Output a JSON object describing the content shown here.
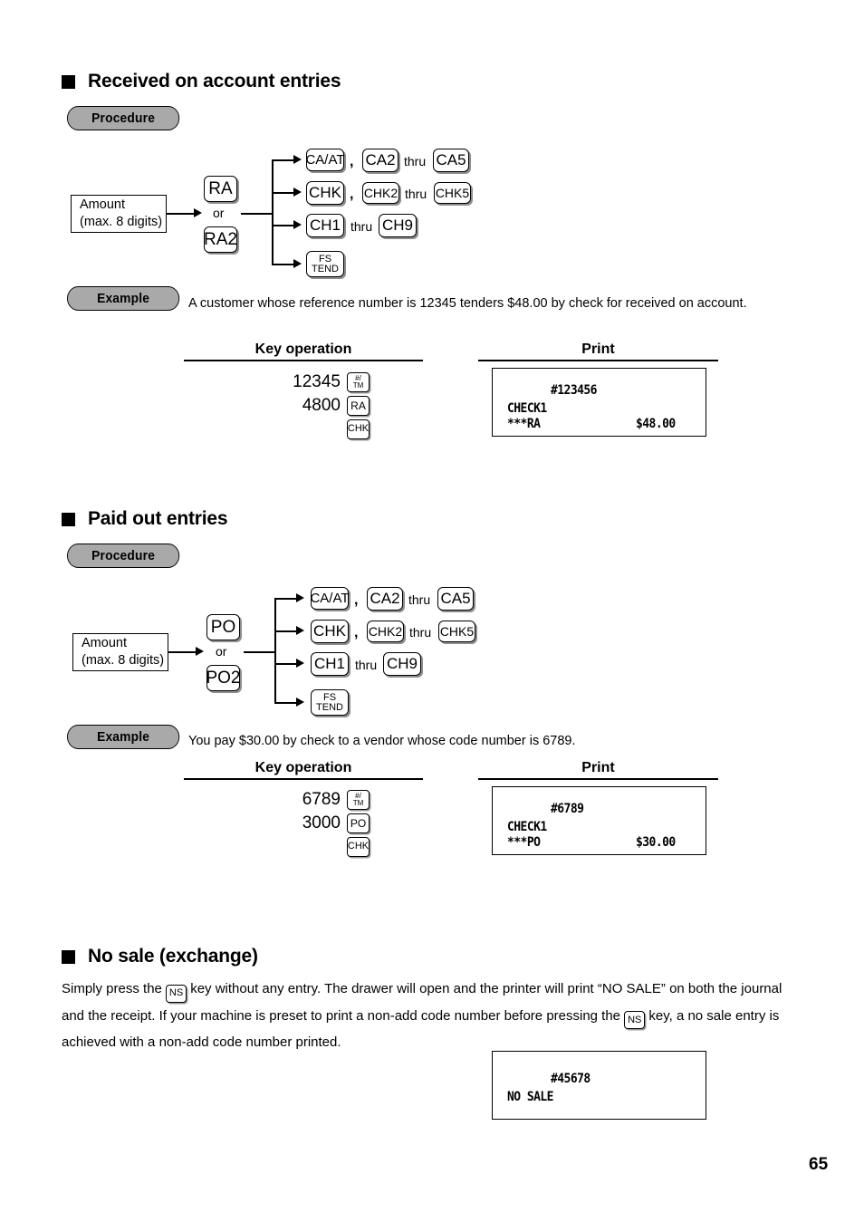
{
  "page": {
    "number": "65"
  },
  "sections": [
    {
      "id": "received-on-account",
      "heading": "Received on account entries",
      "procedure_badge": "Procedure",
      "example_badge": "Example",
      "example_text": "A customer whose reference number is 12345 tenders $48.00 by check for received on account.",
      "flow": {
        "amount_line1": "Amount",
        "amount_line2": "(max. 8 digits)",
        "or_label": "or",
        "primary_keys": [
          "RA",
          "RA2"
        ],
        "branches": [
          {
            "keys": [
              "CA/AT",
              "CA2",
              "CA5"
            ],
            "separator": ",",
            "range_label": "thru"
          },
          {
            "keys": [
              "CHK",
              "CHK2",
              "CHK5"
            ],
            "separator": ",",
            "range_label": "thru"
          },
          {
            "keys": [
              "CH1",
              "CH9"
            ],
            "range_label": "thru"
          },
          {
            "keys": [
              "FS TEND"
            ]
          }
        ]
      },
      "columns": {
        "key_operation": "Key operation",
        "print": "Print"
      },
      "key_operations": [
        {
          "number": "12345",
          "key": "#/TM"
        },
        {
          "number": "4800",
          "key": "RA"
        },
        {
          "number": "",
          "key": "CHK"
        }
      ],
      "receipt": {
        "code": "#123456",
        "label": "CHECK1",
        "entry": "***RA",
        "amount": "$48.00"
      }
    },
    {
      "id": "paid-out",
      "heading": "Paid out entries",
      "procedure_badge": "Procedure",
      "example_badge": "Example",
      "example_text": "You pay $30.00 by check to a vendor whose code number is 6789.",
      "flow": {
        "amount_line1": "Amount",
        "amount_line2": "(max. 8 digits)",
        "or_label": "or",
        "primary_keys": [
          "PO",
          "PO2"
        ],
        "branches": [
          {
            "keys": [
              "CA/AT",
              "CA2",
              "CA5"
            ],
            "separator": ",",
            "range_label": "thru"
          },
          {
            "keys": [
              "CHK",
              "CHK2",
              "CHK5"
            ],
            "separator": ",",
            "range_label": "thru"
          },
          {
            "keys": [
              "CH1",
              "CH9"
            ],
            "range_label": "thru"
          },
          {
            "keys": [
              "FS TEND"
            ]
          }
        ]
      },
      "columns": {
        "key_operation": "Key operation",
        "print": "Print"
      },
      "key_operations": [
        {
          "number": "6789",
          "key": "#/TM"
        },
        {
          "number": "3000",
          "key": "PO"
        },
        {
          "number": "",
          "key": "CHK"
        }
      ],
      "receipt": {
        "code": "#6789",
        "label": "CHECK1",
        "entry": "***PO",
        "amount": "$30.00"
      }
    },
    {
      "id": "no-sale",
      "heading": "No sale (exchange)",
      "paragraph": {
        "p1": "Simply press the",
        "key1": "NS",
        "p2": "key without any entry.  The drawer will open and the printer will print “NO SALE” on both the journal and the receipt.  If your machine is preset to print a non-add code number before pressing the",
        "key2": "NS",
        "p3": "key, a no sale entry is achieved with a non-add code number printed."
      },
      "receipt": {
        "code": "#45678",
        "label": "NO SALE"
      }
    }
  ],
  "keycap_labels": {
    "ca_at": "CA/AT",
    "ca2": "CA2",
    "ca5": "CA5",
    "chk": "CHK",
    "chk2": "CHK2",
    "chk5": "CHK5",
    "ch1": "CH1",
    "ch9": "CH9",
    "fs": "FS",
    "tend": "TEND",
    "ra": "RA",
    "ra2": "RA2",
    "po": "PO",
    "po2": "PO2",
    "ns": "NS",
    "hash": "#/",
    "tm": "TM"
  },
  "labels": {
    "thru": "thru",
    "comma": ",",
    "or": "or"
  },
  "colors": {
    "badge_gray": "#a9a9a9",
    "key_shadow": "#8e8e8e",
    "ink": "#000000",
    "paper": "#ffffff"
  }
}
